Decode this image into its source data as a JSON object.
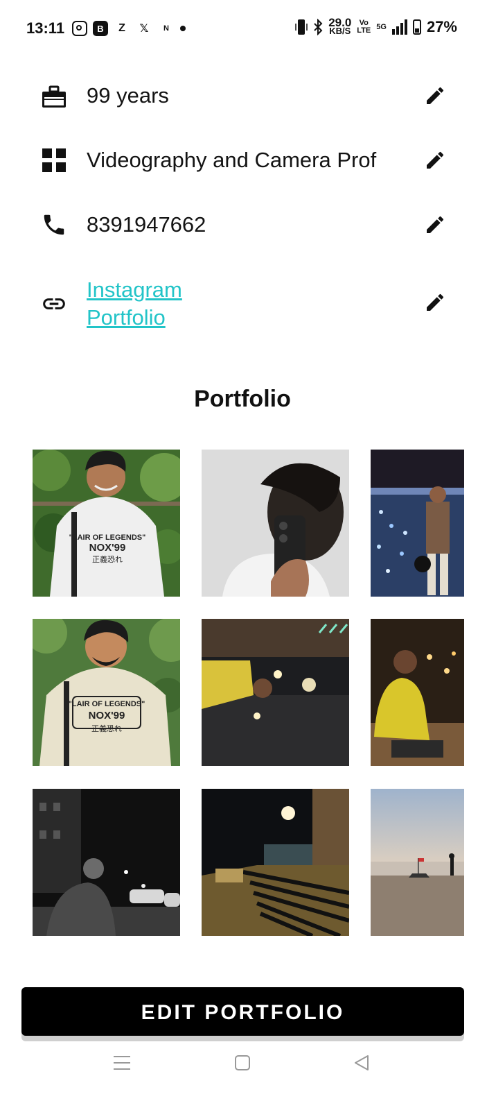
{
  "status_bar": {
    "time": "13:11",
    "speed_value": "29.0",
    "speed_unit": "KB/S",
    "volte_top": "Vo",
    "volte_bottom": "LTE",
    "network": "5G",
    "battery": "27%"
  },
  "details": {
    "experience": "99 years",
    "category": "Videography and Camera Prof",
    "phone": "8391947662",
    "link_label": "Instagram Portfolio"
  },
  "icons": {
    "experience": "briefcase-icon",
    "category": "grid-icon",
    "phone": "phone-icon",
    "link": "link-icon",
    "edit": "pencil-icon"
  },
  "portfolio": {
    "title": "Portfolio",
    "tiles": [
      {
        "t1": "\"LAIR OF LEGENDS\"",
        "t2": "NOX'99",
        "t3": "正義恐れ"
      },
      {},
      {},
      {
        "t1": "\"LAIR OF LEGENDS\"",
        "t2": "NOX'99",
        "t3": "正義恐れ"
      },
      {},
      {},
      {},
      {},
      {}
    ]
  },
  "edit_button": "EDIT PORTFOLIO",
  "nav": [
    "menu-icon",
    "home-square-icon",
    "back-triangle-icon"
  ]
}
